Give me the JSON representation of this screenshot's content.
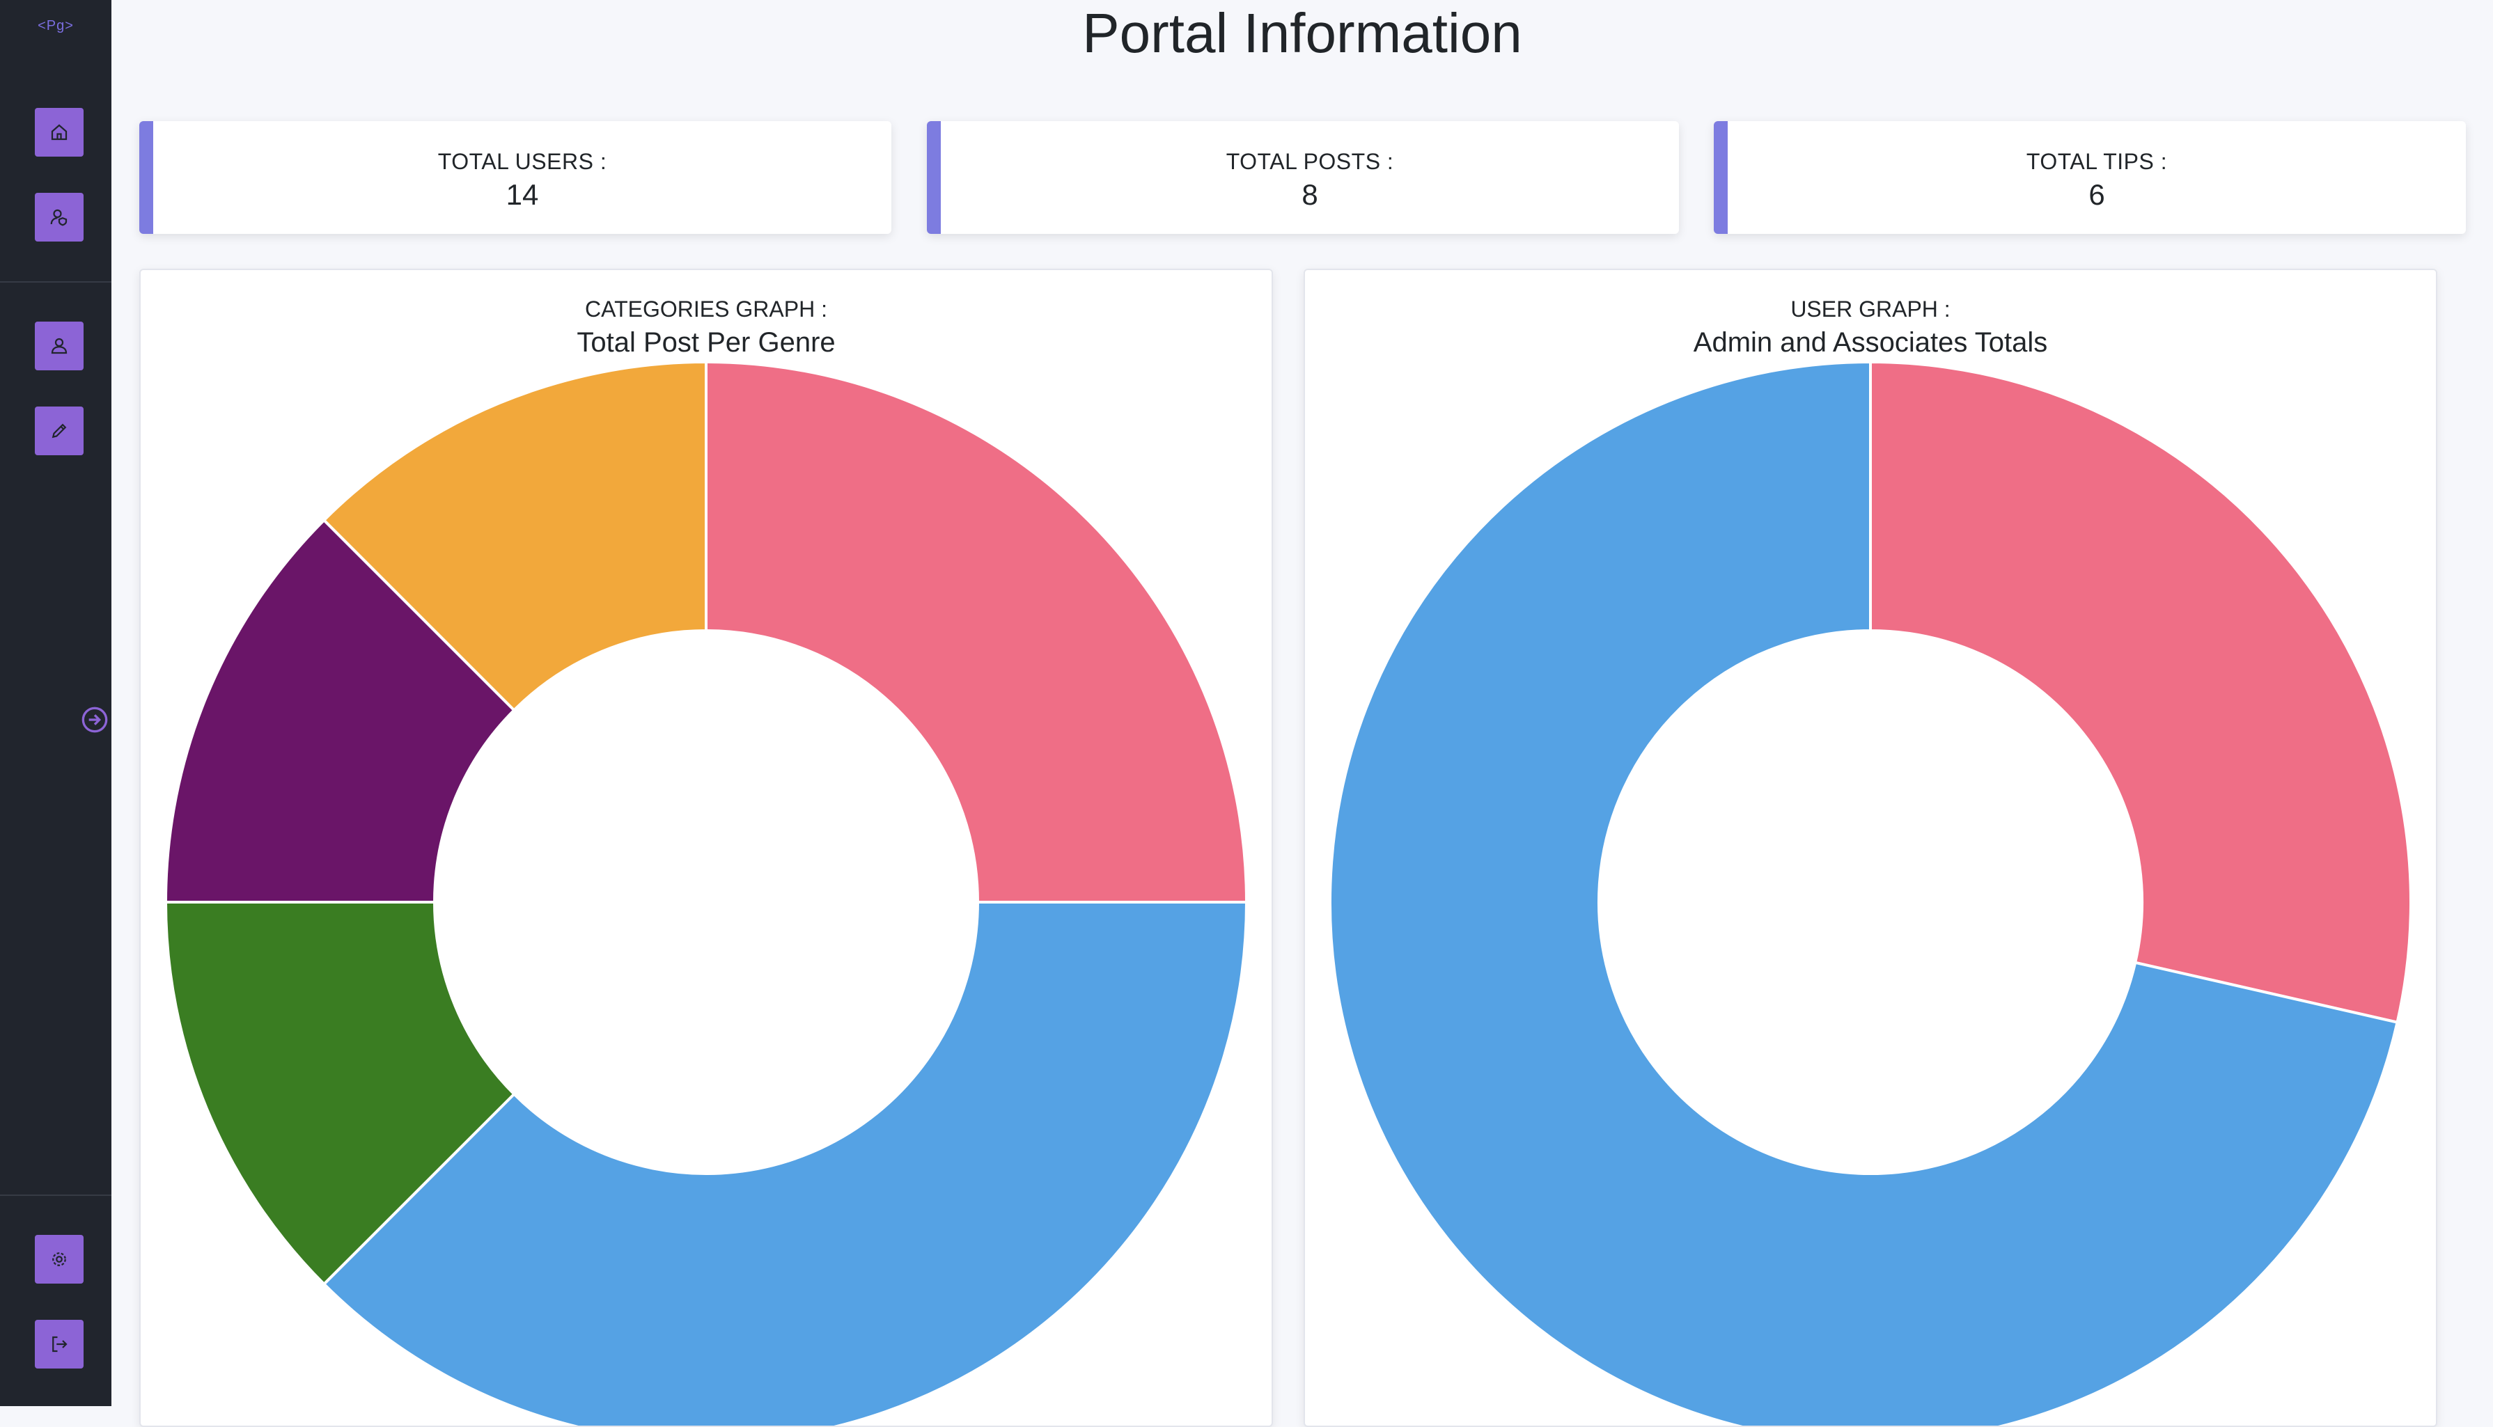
{
  "sidebar": {
    "logo_text": "<Pg>",
    "items": [
      {
        "name": "home-icon"
      },
      {
        "name": "user-shield-icon"
      },
      {
        "name": "user-icon"
      },
      {
        "name": "pencil-icon"
      },
      {
        "name": "gear-icon"
      },
      {
        "name": "logout-icon"
      }
    ],
    "expand_icon": "arrow-circle-right-icon",
    "accent_color": "#8c64d6"
  },
  "page_title": "Portal Information",
  "stats": [
    {
      "label": "TOTAL USERS :",
      "value": "14"
    },
    {
      "label": "TOTAL POSTS :",
      "value": "8"
    },
    {
      "label": "TOTAL TIPS :",
      "value": "6"
    }
  ],
  "charts": {
    "categories": {
      "caption": "CATEGORIES GRAPH :",
      "title": "Total Post Per Genre"
    },
    "users": {
      "caption": "USER GRAPH :",
      "title": "Admin and Associates Totals"
    }
  },
  "chart_data": [
    {
      "type": "pie",
      "title": "Total Post Per Genre",
      "donut": true,
      "values": [
        2,
        3,
        1,
        1,
        1
      ],
      "colors": [
        "#ef6e86",
        "#55a2e4",
        "#3a7d22",
        "#6a1568",
        "#f2a83b"
      ]
    },
    {
      "type": "pie",
      "title": "Admin and Associates Totals",
      "donut": true,
      "values": [
        4,
        10
      ],
      "colors": [
        "#ef6e86",
        "#55a2e4"
      ]
    }
  ]
}
